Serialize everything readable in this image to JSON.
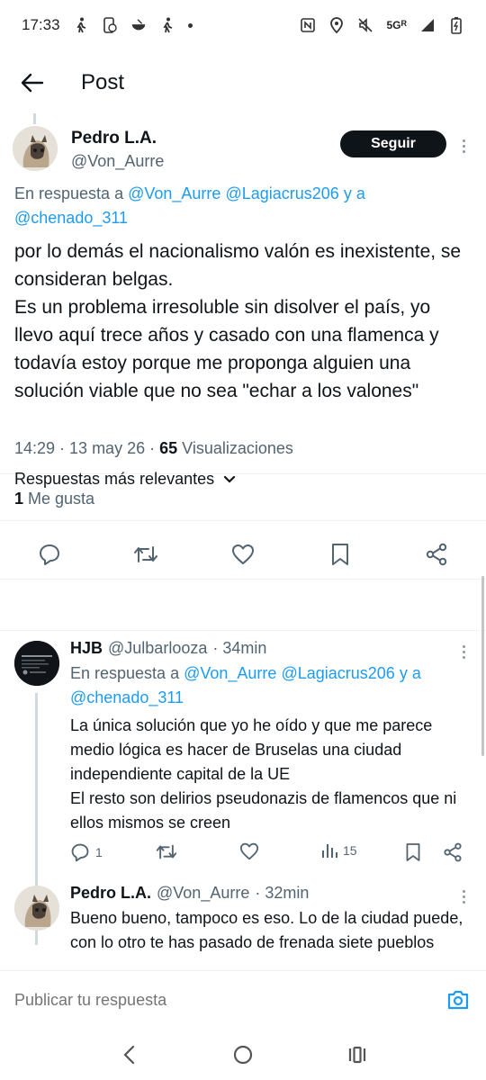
{
  "status_bar": {
    "time": "17:33",
    "network": "5G",
    "signal_badge": "R"
  },
  "header": {
    "title": "Post"
  },
  "main_post": {
    "author_name": "Pedro L.A.",
    "author_handle": "@Von_Aurre",
    "follow_label": "Seguir",
    "reply_prefix": "En respuesta a",
    "reply_mentions": [
      "@Von_Aurre",
      "@Lagiacrus206",
      "@chenado_311"
    ],
    "reply_join": "y a",
    "body": "por lo demás el nacionalismo valón es inexistente, se consideran belgas.\nEs un problema irresoluble sin disolver el país, yo llevo aquí trece años y casado con una flamenca y todavía estoy porque me proponga alguien una solución viable que no sea \"echar a los valones\"",
    "time": "14:29 · 13 may 26 ·",
    "views_count": "65",
    "views_label": "Visualizaciones",
    "likes_count": "1",
    "likes_label": "Me gusta"
  },
  "sort": {
    "label": "Respuestas más relevantes"
  },
  "replies": [
    {
      "author_name": "HJB",
      "author_handle": "@Julbarlooza",
      "time": "· 34min",
      "reply_prefix": "En respuesta a",
      "reply_mentions": [
        "@Von_Aurre",
        "@Lagiacrus206",
        "@chenado_311"
      ],
      "reply_join": "y a",
      "body": "La única solución que yo he oído y que me parece medio lógica es hacer de Bruselas una ciudad independiente capital de la UE\nEl resto son delirios pseudonazis de flamencos que ni ellos mismos se creen",
      "reply_count": "1",
      "views": "15"
    },
    {
      "author_name": "Pedro L.A.",
      "author_handle": "@Von_Aurre",
      "time": "· 32min",
      "body": "Bueno bueno, tampoco es eso. Lo de la ciudad puede, con lo otro te has pasado de frenada siete pueblos"
    }
  ],
  "composer": {
    "placeholder": "Publicar tu respuesta"
  },
  "colors": {
    "link": "#1d9bf0",
    "text": "#0f1419",
    "muted": "#536471",
    "follow_bg": "#0f1419"
  },
  "icons": [
    "back-arrow-icon",
    "more-icon",
    "reply-icon",
    "retweet-icon",
    "like-icon",
    "bookmark-icon",
    "share-icon",
    "views-icon",
    "chevron-down-icon",
    "camera-icon",
    "nav-back-icon",
    "nav-home-icon",
    "nav-recents-icon"
  ]
}
